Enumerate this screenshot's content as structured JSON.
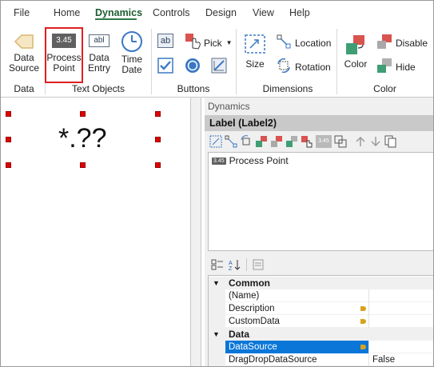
{
  "tabs": [
    "File",
    "Home",
    "Dynamics",
    "Controls",
    "Design",
    "View",
    "Help"
  ],
  "active_tab": "Dynamics",
  "ribbon": {
    "data_group": {
      "label": "Data",
      "button": "Data Source"
    },
    "text_objects_group": {
      "label": "Text Objects",
      "process_point": {
        "icon_text": "3.45",
        "label": "Process Point"
      },
      "data_entry": {
        "icon_text": "abl",
        "label": "Data Entry"
      },
      "time_date": {
        "label": "Time Date"
      }
    },
    "buttons_group": {
      "label": "Buttons",
      "pick_label": "Pick",
      "text_icon": "ab"
    },
    "dimensions_group": {
      "label": "Dimensions",
      "size": "Size",
      "location": "Location",
      "rotation": "Rotation"
    },
    "color_group": {
      "label": "Color",
      "color": "Color",
      "disable": "Disable",
      "hide": "Hide"
    }
  },
  "canvas": {
    "label_text": "*.??"
  },
  "panel": {
    "title": "Dynamics",
    "header": "Label (Label2)",
    "dynamics_item": {
      "chip": "3.45",
      "label": "Process Point"
    },
    "toolbar_chip": "3.45"
  },
  "properties": {
    "categories": [
      {
        "name": "Common",
        "rows": [
          {
            "name": "(Name)",
            "value": "",
            "marker": false
          },
          {
            "name": "Description",
            "value": "",
            "marker": true
          },
          {
            "name": "CustomData",
            "value": "",
            "marker": true
          }
        ]
      },
      {
        "name": "Data",
        "rows": [
          {
            "name": "DataSource",
            "value": "",
            "marker": true,
            "selected": true
          },
          {
            "name": "DragDropDataSource",
            "value": "False",
            "marker": false
          }
        ]
      }
    ]
  },
  "colors": {
    "accent": "#2f7a46",
    "selection": "#0a76d8",
    "handle": "#e00000",
    "marker": "#d8a21e"
  }
}
